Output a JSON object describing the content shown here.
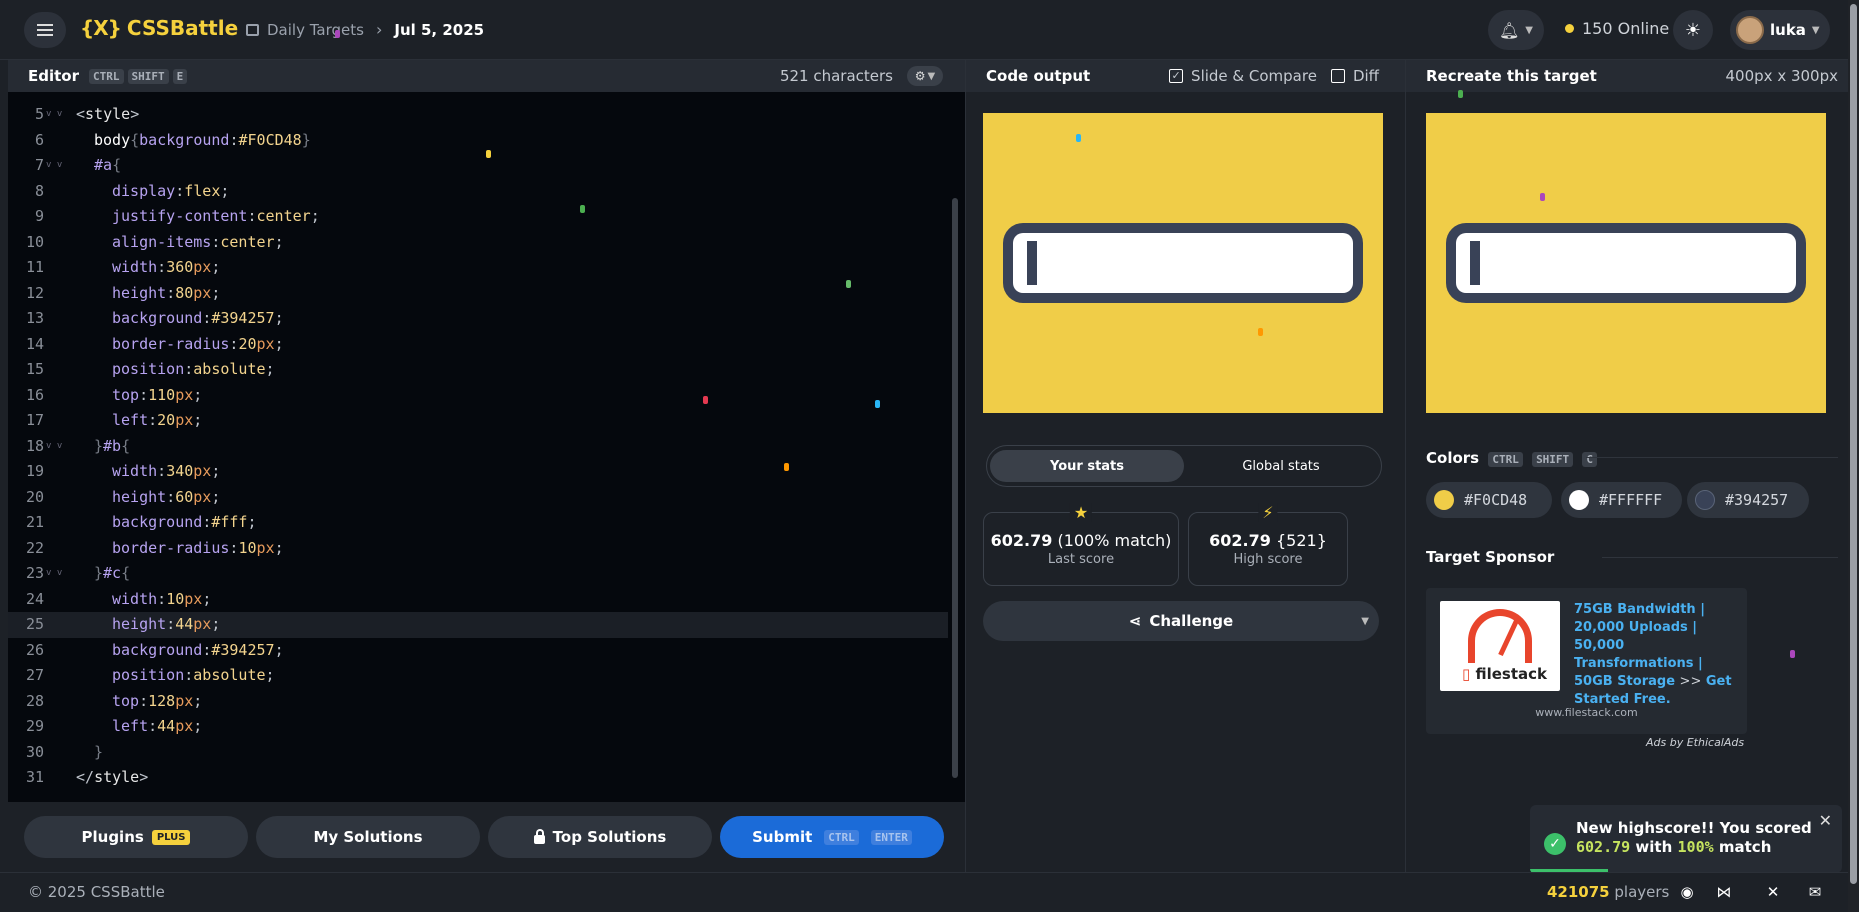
{
  "header": {
    "logo_mark": "{X}",
    "logo_text": "CSSBattle",
    "breadcrumb": [
      "Daily Targets",
      "Jul 5, 2025"
    ],
    "online": "150 Online",
    "username": "luka"
  },
  "editor": {
    "title": "Editor",
    "shortcut": [
      "CTRL",
      "SHIFT",
      "E"
    ],
    "char_count": "521 characters",
    "lines": [
      {
        "n": "5",
        "fold": true,
        "parts": [
          [
            "punc",
            "<"
          ],
          [
            "tag",
            "style"
          ],
          [
            "punc",
            ">"
          ]
        ]
      },
      {
        "n": "6",
        "indent": 1,
        "parts": [
          [
            "sel",
            "body"
          ],
          [
            "dim",
            "{"
          ],
          [
            "prop",
            "background"
          ],
          [
            "punc",
            ":"
          ],
          [
            "val",
            "#F0CD48"
          ],
          [
            "dim",
            "}"
          ]
        ]
      },
      {
        "n": "7",
        "fold": true,
        "indent": 1,
        "parts": [
          [
            "prop",
            "#a"
          ],
          [
            "dim",
            "{"
          ]
        ]
      },
      {
        "n": "8",
        "indent": 2,
        "parts": [
          [
            "prop",
            "display"
          ],
          [
            "punc",
            ":"
          ],
          [
            "val",
            "flex"
          ],
          [
            "punc",
            ";"
          ]
        ]
      },
      {
        "n": "9",
        "indent": 2,
        "parts": [
          [
            "prop",
            "justify-content"
          ],
          [
            "punc",
            ":"
          ],
          [
            "val",
            "center"
          ],
          [
            "punc",
            ";"
          ]
        ]
      },
      {
        "n": "10",
        "indent": 2,
        "parts": [
          [
            "prop",
            "align-items"
          ],
          [
            "punc",
            ":"
          ],
          [
            "val",
            "center"
          ],
          [
            "punc",
            ";"
          ]
        ]
      },
      {
        "n": "11",
        "indent": 2,
        "parts": [
          [
            "prop",
            "width"
          ],
          [
            "punc",
            ":"
          ],
          [
            "val",
            "360"
          ],
          [
            "unit",
            "px"
          ],
          [
            "punc",
            ";"
          ]
        ]
      },
      {
        "n": "12",
        "indent": 2,
        "parts": [
          [
            "prop",
            "height"
          ],
          [
            "punc",
            ":"
          ],
          [
            "val",
            "80"
          ],
          [
            "unit",
            "px"
          ],
          [
            "punc",
            ";"
          ]
        ]
      },
      {
        "n": "13",
        "indent": 2,
        "parts": [
          [
            "prop",
            "background"
          ],
          [
            "punc",
            ":"
          ],
          [
            "val",
            "#394257"
          ],
          [
            "punc",
            ";"
          ]
        ]
      },
      {
        "n": "14",
        "indent": 2,
        "parts": [
          [
            "prop",
            "border-radius"
          ],
          [
            "punc",
            ":"
          ],
          [
            "val",
            "20"
          ],
          [
            "unit",
            "px"
          ],
          [
            "punc",
            ";"
          ]
        ]
      },
      {
        "n": "15",
        "indent": 2,
        "parts": [
          [
            "prop",
            "position"
          ],
          [
            "punc",
            ":"
          ],
          [
            "val",
            "absolute"
          ],
          [
            "punc",
            ";"
          ]
        ]
      },
      {
        "n": "16",
        "indent": 2,
        "parts": [
          [
            "prop",
            "top"
          ],
          [
            "punc",
            ":"
          ],
          [
            "val",
            "110"
          ],
          [
            "unit",
            "px"
          ],
          [
            "punc",
            ";"
          ]
        ]
      },
      {
        "n": "17",
        "indent": 2,
        "parts": [
          [
            "prop",
            "left"
          ],
          [
            "punc",
            ":"
          ],
          [
            "val",
            "20"
          ],
          [
            "unit",
            "px"
          ],
          [
            "punc",
            ";"
          ]
        ]
      },
      {
        "n": "18",
        "fold": true,
        "indent": 1,
        "parts": [
          [
            "dim",
            "}"
          ],
          [
            "prop",
            "#b"
          ],
          [
            "dim",
            "{"
          ]
        ]
      },
      {
        "n": "19",
        "indent": 2,
        "parts": [
          [
            "prop",
            "width"
          ],
          [
            "punc",
            ":"
          ],
          [
            "val",
            "340"
          ],
          [
            "unit",
            "px"
          ],
          [
            "punc",
            ";"
          ]
        ]
      },
      {
        "n": "20",
        "indent": 2,
        "parts": [
          [
            "prop",
            "height"
          ],
          [
            "punc",
            ":"
          ],
          [
            "val",
            "60"
          ],
          [
            "unit",
            "px"
          ],
          [
            "punc",
            ";"
          ]
        ]
      },
      {
        "n": "21",
        "indent": 2,
        "parts": [
          [
            "prop",
            "background"
          ],
          [
            "punc",
            ":"
          ],
          [
            "val",
            "#fff"
          ],
          [
            "punc",
            ";"
          ]
        ]
      },
      {
        "n": "22",
        "indent": 2,
        "parts": [
          [
            "prop",
            "border-radius"
          ],
          [
            "punc",
            ":"
          ],
          [
            "val",
            "10"
          ],
          [
            "unit",
            "px"
          ],
          [
            "punc",
            ";"
          ]
        ]
      },
      {
        "n": "23",
        "fold": true,
        "indent": 1,
        "parts": [
          [
            "dim",
            "}"
          ],
          [
            "prop",
            "#c"
          ],
          [
            "dim",
            "{"
          ]
        ]
      },
      {
        "n": "24",
        "indent": 2,
        "parts": [
          [
            "prop",
            "width"
          ],
          [
            "punc",
            ":"
          ],
          [
            "val",
            "10"
          ],
          [
            "unit",
            "px"
          ],
          [
            "punc",
            ";"
          ]
        ]
      },
      {
        "n": "25",
        "indent": 2,
        "active": true,
        "parts": [
          [
            "prop",
            "height"
          ],
          [
            "punc",
            ":"
          ],
          [
            "val",
            "44"
          ],
          [
            "unit",
            "px"
          ],
          [
            "punc",
            ";"
          ]
        ]
      },
      {
        "n": "26",
        "indent": 2,
        "parts": [
          [
            "prop",
            "background"
          ],
          [
            "punc",
            ":"
          ],
          [
            "val",
            "#394257"
          ],
          [
            "punc",
            ";"
          ]
        ]
      },
      {
        "n": "27",
        "indent": 2,
        "parts": [
          [
            "prop",
            "position"
          ],
          [
            "punc",
            ":"
          ],
          [
            "val",
            "absolute"
          ],
          [
            "punc",
            ";"
          ]
        ]
      },
      {
        "n": "28",
        "indent": 2,
        "parts": [
          [
            "prop",
            "top"
          ],
          [
            "punc",
            ":"
          ],
          [
            "val",
            "128"
          ],
          [
            "unit",
            "px"
          ],
          [
            "punc",
            ";"
          ]
        ]
      },
      {
        "n": "29",
        "indent": 2,
        "parts": [
          [
            "prop",
            "left"
          ],
          [
            "punc",
            ":"
          ],
          [
            "val",
            "44"
          ],
          [
            "unit",
            "px"
          ],
          [
            "punc",
            ";"
          ]
        ]
      },
      {
        "n": "30",
        "indent": 1,
        "parts": [
          [
            "dim",
            "}"
          ]
        ]
      },
      {
        "n": "31",
        "parts": [
          [
            "punc",
            "</"
          ],
          [
            "tag",
            "style"
          ],
          [
            "punc",
            ">"
          ]
        ]
      }
    ]
  },
  "footer_buttons": {
    "plugins": "Plugins",
    "plus_badge": "PLUS",
    "my_solutions": "My Solutions",
    "top_solutions": "Top Solutions",
    "submit": "Submit",
    "submit_kbd": [
      "CTRL",
      "ENTER"
    ]
  },
  "output": {
    "title": "Code output",
    "slide_compare": "Slide & Compare",
    "slide_compare_checked": true,
    "diff": "Diff",
    "diff_checked": false,
    "tabs": [
      "Your stats",
      "Global stats"
    ],
    "last_score_value": "602.79",
    "last_score_match": "(100% match)",
    "last_score_label": "Last score",
    "high_score_value": "602.79",
    "high_score_chars": "{521}",
    "high_score_label": "High score",
    "challenge": "Challenge"
  },
  "target": {
    "title": "Recreate this target",
    "dims": "400px x 300px",
    "colors_title": "Colors",
    "colors_kbd": [
      "CTRL",
      "SHIFT",
      "C"
    ],
    "colors": [
      {
        "hex": "#F0CD48",
        "color": "#F0CD48"
      },
      {
        "hex": "#FFFFFF",
        "color": "#FFFFFF"
      },
      {
        "hex": "#394257",
        "color": "#394257"
      }
    ],
    "sponsor_title": "Target Sponsor",
    "ad_brand": "filestack",
    "ad_copy_1": "75GB Bandwidth | 20,000 Uploads | 50,000 Transformations | 50GB Storage",
    "ad_copy_sep": ">>",
    "ad_copy_2": "Get Started Free.",
    "ad_url": "www.filestack.com",
    "ad_by": "Ads by EthicalAds"
  },
  "toast": {
    "line1": "New highscore!! You scored",
    "score": "602.79",
    "with": "with",
    "match": "100%",
    "match_word": "match"
  },
  "footer": {
    "copyright": "© 2025 CSSBattle",
    "players_count": "421075",
    "players_label": "players"
  },
  "colors": {
    "accent": "#F5D13D",
    "submit": "#1B6BD8",
    "success": "#3CC06A"
  }
}
